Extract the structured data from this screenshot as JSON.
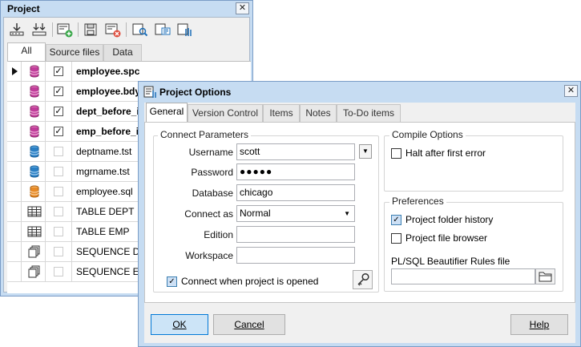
{
  "project": {
    "title": "Project",
    "tabs": [
      "All",
      "Source files",
      "Data"
    ],
    "rows": [
      {
        "name": "employee.spc",
        "bold": true,
        "checked": true,
        "icon": "package-spec-icon"
      },
      {
        "name": "employee.bdy",
        "bold": true,
        "checked": true,
        "icon": "package-body-icon"
      },
      {
        "name": "dept_before_in",
        "bold": true,
        "checked": true,
        "icon": "trigger-icon"
      },
      {
        "name": "emp_before_in",
        "bold": true,
        "checked": true,
        "icon": "trigger-icon"
      },
      {
        "name": "deptname.tst",
        "bold": false,
        "checked": false,
        "icon": "test-script-icon"
      },
      {
        "name": "mgrname.tst",
        "bold": false,
        "checked": false,
        "icon": "test-script-icon"
      },
      {
        "name": "employee.sql",
        "bold": false,
        "checked": false,
        "icon": "sql-script-icon"
      },
      {
        "name": "TABLE DEPT",
        "bold": false,
        "checked": false,
        "icon": "table-icon"
      },
      {
        "name": "TABLE EMP",
        "bold": false,
        "checked": false,
        "icon": "table-icon"
      },
      {
        "name": "SEQUENCE DEPT",
        "bold": false,
        "checked": false,
        "icon": "sequence-icon"
      },
      {
        "name": "SEQUENCE EMP",
        "bold": false,
        "checked": false,
        "icon": "sequence-icon"
      }
    ]
  },
  "dialog": {
    "title": "Project Options",
    "tabs": [
      "General",
      "Version Control",
      "Items",
      "Notes",
      "To-Do items"
    ],
    "connect": {
      "legend": "Connect Parameters",
      "username_label": "Username",
      "username": "scott",
      "password_label": "Password",
      "password": "●●●●●",
      "database_label": "Database",
      "database": "chicago",
      "connect_as_label": "Connect as",
      "connect_as": "Normal",
      "edition_label": "Edition",
      "edition": "",
      "workspace_label": "Workspace",
      "workspace": "",
      "connect_on_open_label": "Connect when project is opened",
      "connect_on_open": true
    },
    "compile": {
      "legend": "Compile Options",
      "halt_label": "Halt after first error",
      "halt": false
    },
    "prefs": {
      "legend": "Preferences",
      "history_label": "Project folder history",
      "history": true,
      "browser_label": "Project file browser",
      "browser": false,
      "beautifier_label": "PL/SQL Beautifier Rules file",
      "beautifier_value": ""
    },
    "buttons": {
      "ok": "OK",
      "cancel": "Cancel",
      "help": "Help"
    }
  },
  "colors": {
    "frame": "#c6dcf2",
    "accent": "#0078d7"
  }
}
